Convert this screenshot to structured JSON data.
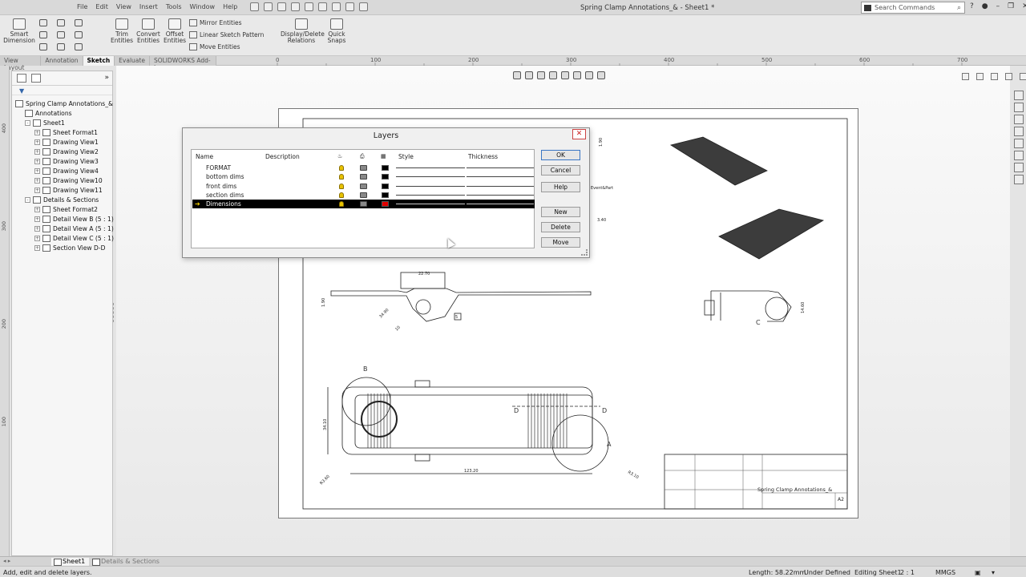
{
  "window": {
    "menu": [
      "File",
      "Edit",
      "View",
      "Insert",
      "Tools",
      "Window",
      "Help"
    ],
    "doc_title": "Spring Clamp Annotations_& - Sheet1 *",
    "search_placeholder": "Search Commands"
  },
  "ribbon": {
    "smart_dimension": "Smart Dimension",
    "trim_entities": "Trim Entities",
    "convert_entities": "Convert Entities",
    "offset_entities": "Offset Entities",
    "mirror_entities": "Mirror Entities",
    "linear_sketch_pattern": "Linear Sketch Pattern",
    "move_entities": "Move Entities",
    "display_delete_relations": "Display/Delete Relations",
    "quick_snaps": "Quick Snaps"
  },
  "tabs": [
    {
      "label": "View Layout",
      "active": false
    },
    {
      "label": "Annotation",
      "active": false
    },
    {
      "label": "Sketch",
      "active": true
    },
    {
      "label": "Evaluate",
      "active": false
    },
    {
      "label": "SOLIDWORKS Add-Ins",
      "active": false
    }
  ],
  "ruler": {
    "top": [
      "0",
      "100",
      "200",
      "300",
      "400",
      "500",
      "600",
      "700"
    ],
    "left": [
      "400",
      "300",
      "200",
      "100"
    ]
  },
  "tree": {
    "items": [
      {
        "label": "Spring Clamp Annotations_&",
        "level": 0,
        "toggle": ""
      },
      {
        "label": "Annotations",
        "level": 1,
        "toggle": ""
      },
      {
        "label": "Sheet1",
        "level": 1,
        "toggle": "-"
      },
      {
        "label": "Sheet Format1",
        "level": 2,
        "toggle": "+"
      },
      {
        "label": "Drawing View1",
        "level": 2,
        "toggle": "+"
      },
      {
        "label": "Drawing View2",
        "level": 2,
        "toggle": "+"
      },
      {
        "label": "Drawing View3",
        "level": 2,
        "toggle": "+"
      },
      {
        "label": "Drawing View4",
        "level": 2,
        "toggle": "+"
      },
      {
        "label": "Drawing View10",
        "level": 2,
        "toggle": "+"
      },
      {
        "label": "Drawing View11",
        "level": 2,
        "toggle": "+"
      },
      {
        "label": "Details & Sections",
        "level": 1,
        "toggle": "-"
      },
      {
        "label": "Sheet Format2",
        "level": 2,
        "toggle": "+"
      },
      {
        "label": "Detail View B (5 : 1)",
        "level": 2,
        "toggle": "+"
      },
      {
        "label": "Detail View A (5 : 1)",
        "level": 2,
        "toggle": "+"
      },
      {
        "label": "Detail View C (5 : 1)",
        "level": 2,
        "toggle": "+"
      },
      {
        "label": "Section View D-D",
        "level": 2,
        "toggle": "+"
      }
    ]
  },
  "drawing": {
    "dims": {
      "top_width": "22.70",
      "left_h": "1.90",
      "angle1": "34.90",
      "angle2": "10",
      "side_h": "14.60",
      "plan_h": "34.10",
      "plan_w": "123.20",
      "r_left": "R3.60",
      "r_right": "R3.10",
      "top_small": "1.90",
      "top_small2": "3.40",
      "note": "Event&Part"
    },
    "callouts": {
      "b": "B",
      "a": "A",
      "c": "C",
      "d1": "D",
      "d2": "D",
      "box": "5"
    },
    "title_block_name": "Spring Clamp Annotations_&",
    "sheet_size": "A2"
  },
  "dialog": {
    "title": "Layers",
    "columns": {
      "name": "Name",
      "description": "Description",
      "style": "Style",
      "thickness": "Thickness"
    },
    "rows": [
      {
        "name": "FORMAT",
        "color": "#000000",
        "selected": false
      },
      {
        "name": "bottom dims",
        "color": "#000000",
        "selected": false
      },
      {
        "name": "front dims",
        "color": "#000000",
        "selected": false
      },
      {
        "name": "section dims",
        "color": "#000000",
        "selected": false
      },
      {
        "name": "Dimensions",
        "color": "#e00000",
        "selected": true
      }
    ],
    "buttons": {
      "ok": "OK",
      "cancel": "Cancel",
      "help": "Help",
      "new": "New",
      "delete": "Delete",
      "move": "Move"
    }
  },
  "sheet_tabs": [
    {
      "label": "Sheet1",
      "active": true
    },
    {
      "label": "Details & Sections",
      "active": false
    }
  ],
  "status": {
    "message": "Add, edit and delete layers.",
    "length": "Length: 58.22mm",
    "state": "Under Defined",
    "editing": "Editing Sheet1",
    "scale": "2 : 1",
    "units": "MMGS"
  }
}
